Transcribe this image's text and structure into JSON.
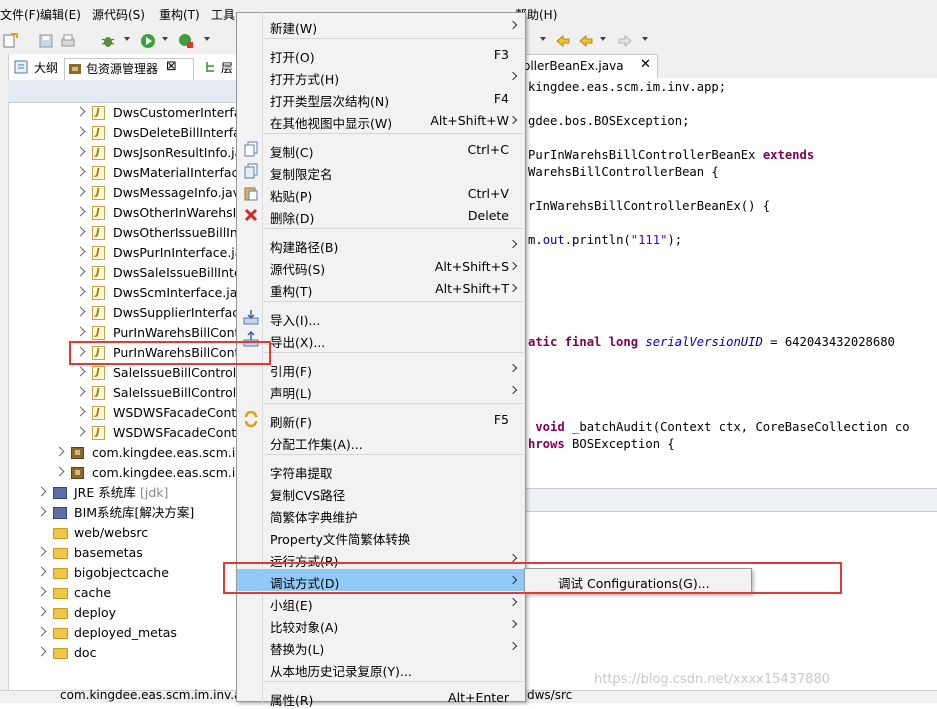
{
  "menubar": {
    "items": [
      "文件(F)",
      "编辑(E)",
      "源代码(S)",
      "重构(T)",
      "工具",
      "帮助(H)"
    ]
  },
  "left_panel": {
    "tabs": [
      {
        "label": "大纲"
      },
      {
        "label": "包资源管理器"
      },
      {
        "label": "层"
      }
    ],
    "tree": [
      {
        "label": "DwsCustomerInterfac",
        "type": "java",
        "level": 2
      },
      {
        "label": "DwsDeleteBillInterfac",
        "type": "java",
        "level": 2
      },
      {
        "label": "DwsJsonResultInfo.ja",
        "type": "java",
        "level": 2
      },
      {
        "label": "DwsMaterialInterface",
        "type": "java",
        "level": 2
      },
      {
        "label": "DwsMessageInfo.java",
        "type": "java",
        "level": 2
      },
      {
        "label": "DwsOtherInWarehsIn",
        "type": "java",
        "level": 2
      },
      {
        "label": "DwsOtherIssueBillInte",
        "type": "java",
        "level": 2
      },
      {
        "label": "DwsPurInInterface.jav",
        "type": "java",
        "level": 2
      },
      {
        "label": "DwsSaleIssueBillInter",
        "type": "java",
        "level": 2
      },
      {
        "label": "DwsScmInterface.java",
        "type": "java",
        "level": 2
      },
      {
        "label": "DwsSupplierInterface",
        "type": "java",
        "level": 2
      },
      {
        "label": "PurInWarehsBillContr",
        "type": "java",
        "level": 2
      },
      {
        "label": "PurInWarehsBillContr",
        "type": "java",
        "level": 2,
        "highlighted": true
      },
      {
        "label": "SaleIssueBillControlle",
        "type": "java",
        "level": 2
      },
      {
        "label": "SaleIssueBillControlle",
        "type": "java",
        "level": 2
      },
      {
        "label": "WSDWSFacadeContr",
        "type": "java",
        "level": 2
      },
      {
        "label": "WSDWSFacadeContr",
        "type": "java",
        "level": 2
      },
      {
        "label": "com.kingdee.eas.scm.im",
        "type": "package",
        "level": 1
      },
      {
        "label": "com.kingdee.eas.scm.im",
        "type": "package",
        "level": 1
      },
      {
        "label": "JRE 系统库 ",
        "suffix": "[jdk]",
        "type": "library",
        "level": 0
      },
      {
        "label": "BIM系统库[解决方案]",
        "type": "library",
        "level": 0
      },
      {
        "label": "web/websrc",
        "type": "folder",
        "level": 0,
        "no_chevron": true
      },
      {
        "label": "basemetas",
        "type": "folder",
        "level": 0
      },
      {
        "label": "bigobjectcache",
        "type": "folder",
        "level": 0
      },
      {
        "label": "cache",
        "type": "folder",
        "level": 0
      },
      {
        "label": "deploy",
        "type": "folder",
        "level": 0
      },
      {
        "label": "deployed_metas",
        "type": "folder",
        "level": 0
      },
      {
        "label": "doc",
        "type": "folder",
        "level": 0
      }
    ]
  },
  "editor": {
    "tab_label": "ollerBeanEx.java",
    "lines": [
      [
        {
          "t": "kingdee.eas.scm.im.inv.app;",
          "c": ""
        }
      ],
      [
        {
          "t": "",
          "c": ""
        }
      ],
      [
        {
          "t": "gdee.bos.BOSException;",
          "c": ""
        }
      ],
      [
        {
          "t": "",
          "c": ""
        }
      ],
      [
        {
          "t": "PurInWarehsBillControllerBeanEx ",
          "c": ""
        },
        {
          "t": "extends",
          "c": "kw"
        }
      ],
      [
        {
          "t": "WarehsBillControllerBean {",
          "c": ""
        }
      ],
      [
        {
          "t": "",
          "c": ""
        }
      ],
      [
        {
          "t": "rInWarehsBillControllerBeanEx() {",
          "c": ""
        }
      ],
      [
        {
          "t": "",
          "c": ""
        }
      ],
      [
        {
          "t": "m.",
          "c": ""
        },
        {
          "t": "out",
          "c": "fld"
        },
        {
          "t": ".println(",
          "c": ""
        },
        {
          "t": "\"111\"",
          "c": "str"
        },
        {
          "t": ");",
          "c": ""
        }
      ],
      [
        {
          "t": "",
          "c": ""
        }
      ],
      [
        {
          "t": "",
          "c": ""
        }
      ],
      [
        {
          "t": "",
          "c": ""
        }
      ],
      [
        {
          "t": "",
          "c": ""
        }
      ],
      [
        {
          "t": "",
          "c": ""
        }
      ],
      [
        {
          "t": "atic final long ",
          "c": "kw"
        },
        {
          "t": "serialVersionUID",
          "c": "fld-i"
        },
        {
          "t": " = 642043432028680",
          "c": ""
        }
      ],
      [
        {
          "t": "",
          "c": ""
        }
      ],
      [
        {
          "t": "",
          "c": ""
        }
      ],
      [
        {
          "t": "",
          "c": ""
        }
      ],
      [
        {
          "t": "",
          "c": ""
        }
      ],
      [
        {
          "t": " void",
          "c": "kw"
        },
        {
          "t": " _batchAudit(Context ctx, CoreBaseCollection co",
          "c": ""
        }
      ],
      [
        {
          "t": "hrows",
          "c": "kw"
        },
        {
          "t": " BOSException {",
          "c": ""
        }
      ]
    ]
  },
  "context_menu": {
    "items": [
      {
        "label": "新建(W)",
        "shortcut": "",
        "submenu": true,
        "sep_after": true
      },
      {
        "label": "打开(O)",
        "shortcut": "F3",
        "submenu": false
      },
      {
        "label": "打开方式(H)",
        "shortcut": "",
        "submenu": true
      },
      {
        "label": "打开类型层次结构(N)",
        "shortcut": "F4",
        "submenu": false
      },
      {
        "label": "在其他视图中显示(W)",
        "shortcut": "Alt+Shift+W",
        "submenu": true,
        "sep_after": true
      },
      {
        "label": "复制(C)",
        "shortcut": "Ctrl+C",
        "submenu": false,
        "icon": "copy-icon"
      },
      {
        "label": "复制限定名",
        "shortcut": "",
        "submenu": false,
        "icon": "copy-qualified-icon"
      },
      {
        "label": "粘贴(P)",
        "shortcut": "Ctrl+V",
        "submenu": false,
        "icon": "paste-icon"
      },
      {
        "label": "删除(D)",
        "shortcut": "Delete",
        "submenu": false,
        "icon": "delete-icon",
        "sep_after": true
      },
      {
        "label": "构建路径(B)",
        "shortcut": "",
        "submenu": true
      },
      {
        "label": "源代码(S)",
        "shortcut": "Alt+Shift+S",
        "submenu": true
      },
      {
        "label": "重构(T)",
        "shortcut": "Alt+Shift+T",
        "submenu": true,
        "sep_after": true
      },
      {
        "label": "导入(I)...",
        "shortcut": "",
        "submenu": false,
        "icon": "import-icon"
      },
      {
        "label": "导出(X)...",
        "shortcut": "",
        "submenu": false,
        "icon": "export-icon",
        "sep_after": true
      },
      {
        "label": "引用(F)",
        "shortcut": "",
        "submenu": true
      },
      {
        "label": "声明(L)",
        "shortcut": "",
        "submenu": true,
        "sep_after": true
      },
      {
        "label": "刷新(F)",
        "shortcut": "F5",
        "submenu": false,
        "icon": "refresh-icon"
      },
      {
        "label": "分配工作集(A)...",
        "shortcut": "",
        "submenu": false,
        "sep_after": true
      },
      {
        "label": "字符串提取",
        "shortcut": "",
        "submenu": false
      },
      {
        "label": "复制CVS路径",
        "shortcut": "",
        "submenu": false
      },
      {
        "label": "简繁体字典维护",
        "shortcut": "",
        "submenu": false
      },
      {
        "label": "Property文件简繁体转换",
        "shortcut": "",
        "submenu": false
      },
      {
        "label": "运行方式(R)",
        "shortcut": "",
        "submenu": true
      },
      {
        "label": "调试方式(D)",
        "shortcut": "",
        "submenu": true,
        "highlighted": true
      },
      {
        "label": "小组(E)",
        "shortcut": "",
        "submenu": true
      },
      {
        "label": "比较对象(A)",
        "shortcut": "",
        "submenu": true
      },
      {
        "label": "替换为(L)",
        "shortcut": "",
        "submenu": true
      },
      {
        "label": "从本地历史记录复原(Y)...",
        "shortcut": "",
        "submenu": false,
        "sep_after": true
      },
      {
        "label": "属性(R)",
        "shortcut": "Alt+Enter",
        "submenu": false
      }
    ]
  },
  "submenu": {
    "label": "调试 Configurations(G)..."
  },
  "status_bar": {
    "left": "com.kingdee.eas.scm.im.inv.ap",
    "right": "dws/src"
  },
  "watermark": "https://blog.csdn.net/xxxx15437880",
  "colors": {
    "menu_highlight": "#91c9f7",
    "annotation_red": "#e53935",
    "java_keyword": "#7f0055",
    "java_string": "#2a00ff",
    "java_field": "#0000c0"
  }
}
